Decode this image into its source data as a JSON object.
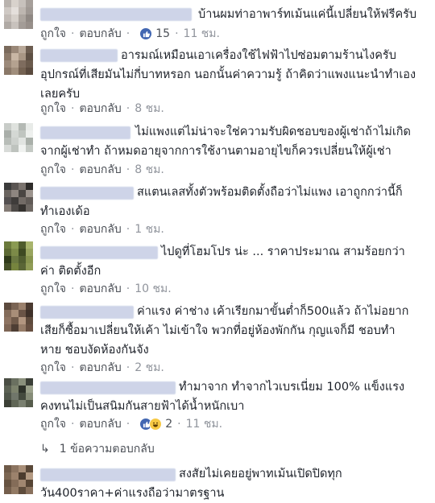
{
  "actions": {
    "like_label": "ถูกใจ",
    "reply_label": "ตอบกลับ",
    "separator": "·"
  },
  "comments": [
    {
      "text": "บ้านผมท่าอาพาร์ทเม้นแค่นี้เปลี่ยนให้ฟรีครับ",
      "reactions": {
        "types": [
          "like-icon"
        ],
        "count": "15"
      },
      "time": "11 ชม.",
      "avatar_colors": [
        "#b9b3ae",
        "#d8d2cc",
        "#c7c1bc",
        "#a69f9a",
        "#cfc9c4",
        "#e4dfdb",
        "#bdb6b0",
        "#9f9893",
        "#c2bbb6",
        "#d6d0ca",
        "#aca59f",
        "#8f8883",
        "#b0aaa5",
        "#c8c2bd",
        "#a39c97",
        "#978f8a"
      ]
    },
    {
      "text": "อารมณ์เหมือนเอาเครื่องใช้ไฟฟ้าไปซ่อมตามร้านไงครับ อุปกรณ์ที่เสียมันไม่กี่บาทหรอก นอกนั้นค่าความรู้ ถ้าคิดว่าแพงแนะนำทำเอง เลยครับ",
      "reactions": null,
      "time": "8 ชม.",
      "avatar_colors": [
        "#7a6a5c",
        "#9a8878",
        "#b8a898",
        "#6c5d50",
        "#8c7a6a",
        "#c8b6a4",
        "#a89684",
        "#5d4f43",
        "#9c8a7a",
        "#b4a290",
        "#7e6c5e",
        "#6a5a4c",
        "#8a7868",
        "#a08e7c",
        "#746252",
        "#5a4a3e"
      ]
    },
    {
      "text": "ไม่แพงแต่ไม่น่าจะใช่ความรับผิดชอบของผู้เช่าถ้าไม่เกิด จากผู้เช่าทำ ถ้าหมดอายุจากการใช้งานตามอายุไขก็ควรเปลี่ยนให้ผู้เช่า",
      "reactions": null,
      "time": "8 ชม.",
      "avatar_colors": [
        "#c8ccc8",
        "#dfe2de",
        "#b4b9b4",
        "#e8ebe8",
        "#a9aea9",
        "#d4d8d4",
        "#c0c5c0",
        "#eef0ee",
        "#b8bdb8",
        "#cdd1cd",
        "#e1e4e1",
        "#aab0aa",
        "#d8dbd8",
        "#bec3be",
        "#f0f2f0",
        "#c4c9c4"
      ]
    },
    {
      "text": "สแตนเลสทั้งตัวพร้อมติดตั้งถือว่าไม่แพง เอาถูกกว่านี้ก็ ทำเองเด้อ",
      "reactions": null,
      "time": "1 ชม.",
      "avatar_colors": [
        "#3b3b3b",
        "#5a5552",
        "#7a736e",
        "#2e2c2a",
        "#6b6560",
        "#8e8680",
        "#4a4643",
        "#9c948e",
        "#545050",
        "#3f3c3a",
        "#726b66",
        "#605a56",
        "#837b75",
        "#4e4a47",
        "#35322f",
        "#6e6863"
      ]
    },
    {
      "text": "ไปดูที่โฮมโปร น่ะ ... ราคาประมาณ สามร้อยกว่า ค่า ติดตั้งอีก",
      "reactions": null,
      "time": "10 ชม.",
      "avatar_colors": [
        "#6b7a3c",
        "#8a9a52",
        "#4f5c2c",
        "#a8b46c",
        "#5d6a34",
        "#7c8a48",
        "#3e4a22",
        "#98a45e",
        "#2f3a1a",
        "#6a7840",
        "#515e30",
        "#87944e",
        "#454f28",
        "#76843e",
        "#5a6636",
        "#909c56"
      ]
    },
    {
      "text": "ค่าแรง ค่าช่าง เค้าเรียกมาขั้นต่ำก็500แล้ว ถ้าไม่อยาก เสียก็ซื้อมาเปลี่ยนให้เค้า ไม่เข้าใจ พวกที่อยู่ห้องพักกัน กุญแจก็มี ชอบทำ หาย ชอบงัดห้องกันจัง",
      "reactions": null,
      "time": "2 ชม.",
      "avatar_colors": [
        "#5c4a3e",
        "#7a6454",
        "#9a806c",
        "#4a3a30",
        "#846c5a",
        "#a88e78",
        "#6a5446",
        "#3e3028",
        "#8e7462",
        "#705a4a",
        "#b29680",
        "#5e4a3c",
        "#7e6656",
        "#4e3e34",
        "#967c68",
        "#664e40"
      ]
    },
    {
      "text": "ทำมาจาก ทำจากไวเบรเนี่ยม 100% แข็งแรง คงทนไม่เป็นสนิมกันสายฟ้าได้น้ำหนักเบา",
      "reactions": {
        "types": [
          "like-icon",
          "haha-icon"
        ],
        "count": "2"
      },
      "time": "11 ชม.",
      "avatar_colors": [
        "#4a4e44",
        "#6a7060",
        "#8a907c",
        "#3a3e36",
        "#5c6254",
        "#7c826c",
        "#2e322a",
        "#9aa08a",
        "#50564a",
        "#70766a",
        "#444a3e",
        "#868c78",
        "#3c4036",
        "#606656",
        "#7a8070",
        "#565c4c"
      ]
    },
    {
      "text": "สงสัยไม่เคยอยู่พาทเม้นเปิดปิดทุก วัน400ราคา+ค่าแรงถือว่ามาตรฐาน",
      "reactions": null,
      "time": "",
      "avatar_colors": [
        "#6e5a48",
        "#8c7460",
        "#a88e78",
        "#5a4838",
        "#7c6652",
        "#9c826c",
        "#4c3c2e",
        "#b49a82",
        "#665240",
        "#846c58",
        "#a08670",
        "#564434",
        "#745e4c",
        "#927a64",
        "#5e4c3c",
        "#88705c"
      ]
    }
  ],
  "replies": {
    "label": "1 ข้อความตอบกลับ",
    "arrow": "↳"
  }
}
